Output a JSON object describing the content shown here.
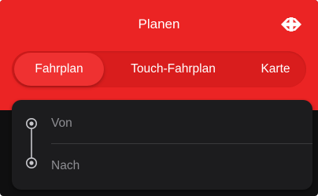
{
  "header": {
    "title": "Planen",
    "logo_icon": "sbb-logo-icon",
    "background_color": "#eb2424"
  },
  "tabs": [
    {
      "label": "Fahrplan",
      "selected": true
    },
    {
      "label": "Touch-Fahrplan",
      "selected": false
    },
    {
      "label": "Karte",
      "selected": false
    }
  ],
  "route": {
    "from_placeholder": "Von",
    "to_placeholder": "Nach",
    "icon": "route-connector-icon"
  }
}
